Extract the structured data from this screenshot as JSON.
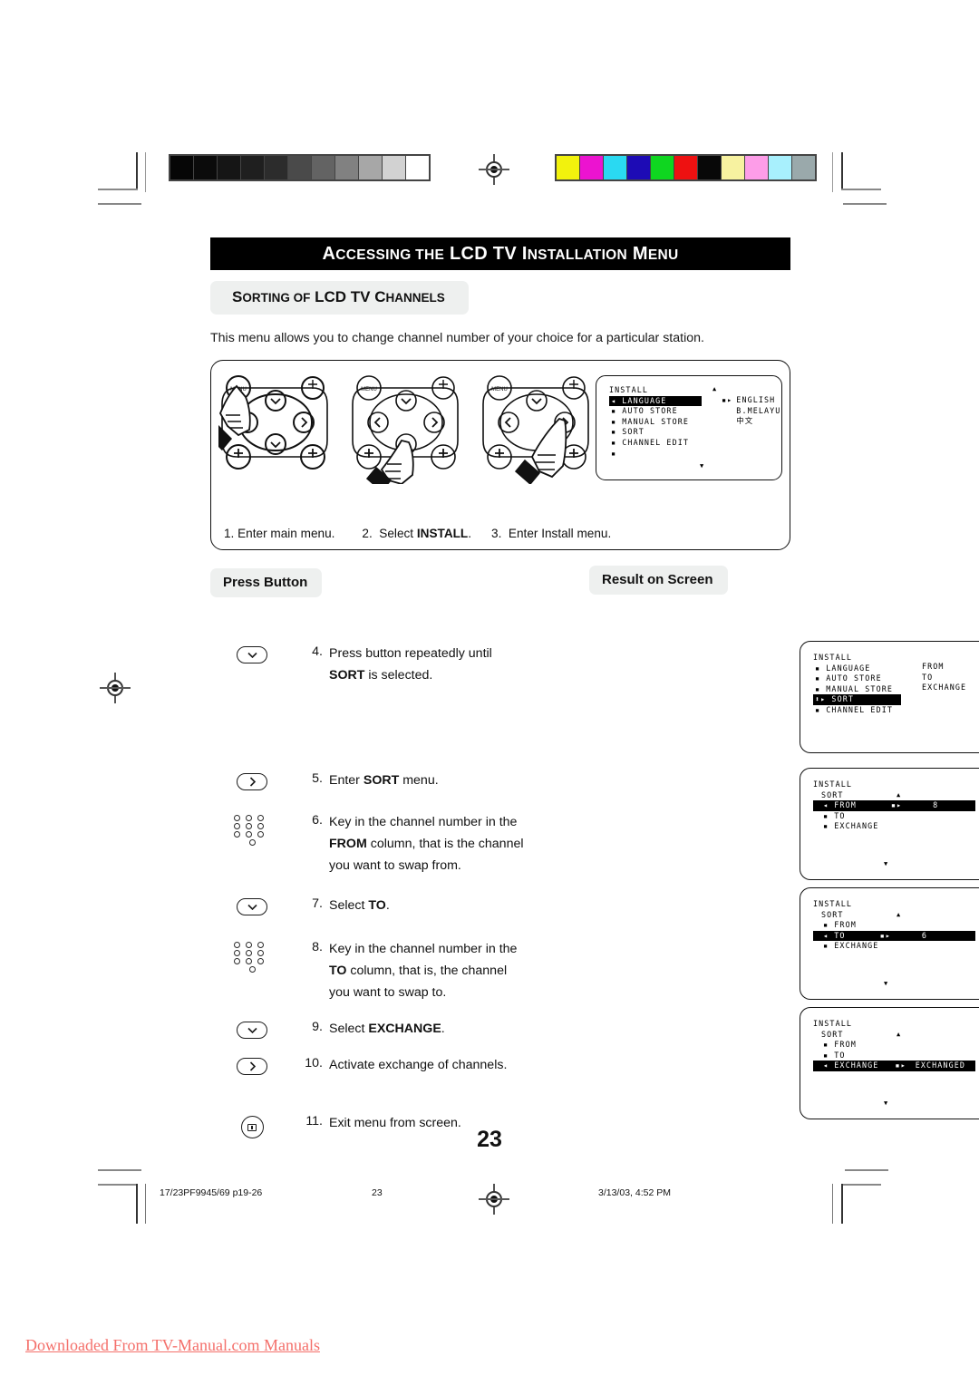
{
  "document": {
    "title": "Accessing the LCD TV Installation Menu",
    "title_parts": [
      {
        "t": "A",
        "big": true
      },
      {
        "t": "CCESSING",
        "big": false
      },
      {
        "t": " ",
        "big": false
      },
      {
        "t": "THE",
        "big": false
      },
      {
        "t": " LCD TV ",
        "big": true
      },
      {
        "t": "I",
        "big": true
      },
      {
        "t": "NSTALLATION",
        "big": false
      },
      {
        "t": " M",
        "big": true
      },
      {
        "t": "ENU",
        "big": false
      }
    ],
    "subtitle": "Sorting of LCD TV Channels",
    "intro": "This menu allows you to change channel number of your choice for a particular station.",
    "page_number": "23"
  },
  "top_panel": {
    "caption": [
      {
        "num": "1.",
        "text": "Enter main menu.",
        "bold": ""
      },
      {
        "num": "2.",
        "pre": "Select ",
        "bold": "INSTALL",
        "post": "."
      },
      {
        "num": "3.",
        "text": "Enter Install menu.",
        "bold": ""
      }
    ],
    "remote_labels": {
      "menu": "MENU",
      "expand": "expand-icon"
    },
    "osd": {
      "header": "INSTALL",
      "arrow_up": "▲",
      "arrow_down": "▼",
      "items": [
        {
          "label": "LANGUAGE",
          "highlight": true,
          "left_arrow": "◂"
        },
        {
          "label": "AUTO STORE",
          "highlight": false
        },
        {
          "label": "MANUAL STORE",
          "highlight": false
        },
        {
          "label": "SORT",
          "highlight": false
        },
        {
          "label": "CHANNEL EDIT",
          "highlight": false
        },
        {
          "label": "",
          "highlight": false
        }
      ],
      "values": [
        {
          "label": "ENGLISH",
          "marker": "▪▸"
        },
        {
          "label": "B.MELAYU",
          "marker": ""
        },
        {
          "label": "中文",
          "marker": ""
        }
      ]
    }
  },
  "columns": {
    "press_button": "Press Button",
    "result_on_screen": "Result on Screen"
  },
  "steps": [
    {
      "num": "4.",
      "icon": "down-arrow-key-icon",
      "lines": [
        {
          "pre": "Press button repeatedly until",
          "bold": "",
          "post": ""
        },
        {
          "pre": "",
          "bold": "SORT",
          "post": " is selected."
        }
      ]
    },
    {
      "num": "5.",
      "icon": "right-arrow-key-icon",
      "lines": [
        {
          "pre": "Enter ",
          "bold": "SORT",
          "post": " menu."
        }
      ]
    },
    {
      "num": "6.",
      "icon": "numeric-keypad-icon",
      "lines": [
        {
          "pre": "Key in the channel number in the",
          "bold": "",
          "post": ""
        },
        {
          "pre": "",
          "bold": "FROM",
          "post": " column, that is the channel"
        },
        {
          "pre": "you want to swap from.",
          "bold": "",
          "post": ""
        }
      ]
    },
    {
      "num": "7.",
      "icon": "down-arrow-key-icon",
      "lines": [
        {
          "pre": "Select ",
          "bold": "TO",
          "post": "."
        }
      ]
    },
    {
      "num": "8.",
      "icon": "numeric-keypad-icon",
      "lines": [
        {
          "pre": "Key in the channel number in the",
          "bold": "",
          "post": ""
        },
        {
          "pre": "",
          "bold": "TO",
          "post": " column,  that is, the channel"
        },
        {
          "pre": "you want to swap to.",
          "bold": "",
          "post": ""
        }
      ]
    },
    {
      "num": "9.",
      "icon": "down-arrow-key-icon",
      "lines": [
        {
          "pre": "Select ",
          "bold": "EXCHANGE",
          "post": "."
        }
      ]
    },
    {
      "num": "10.",
      "icon": "right-arrow-key-icon",
      "lines": [
        {
          "pre": "Activate exchange of channels.",
          "bold": "",
          "post": ""
        }
      ]
    },
    {
      "num": "11.",
      "icon": "exit-menu-key-icon",
      "lines": [
        {
          "pre": "Exit menu from screen.",
          "bold": "",
          "post": ""
        }
      ]
    }
  ],
  "result_screens": [
    {
      "header": "INSTALL",
      "sub": "",
      "arrow_up": "",
      "arrow_down": "",
      "items": [
        {
          "label": "LANGUAGE",
          "highlight": false,
          "bullet": "▪"
        },
        {
          "label": "AUTO STORE",
          "highlight": false,
          "bullet": "▪"
        },
        {
          "label": "MANUAL STORE",
          "highlight": false,
          "bullet": "▪"
        },
        {
          "label": "SORT",
          "highlight": true,
          "bullet": "⬍▸"
        },
        {
          "label": "CHANNEL EDIT",
          "highlight": false,
          "bullet": "▪"
        }
      ],
      "values": [
        "FROM",
        "TO",
        "EXCHANGE"
      ],
      "value_start_index": 0
    },
    {
      "header": "INSTALL",
      "sub": "SORT",
      "arrow_up": "▲",
      "arrow_down": "▼",
      "items": [
        {
          "label": "FROM",
          "highlight": true,
          "bullet": "◂",
          "marker": "▪▸",
          "value": "8"
        },
        {
          "label": "TO",
          "highlight": false,
          "bullet": "▪",
          "marker": "",
          "value": ""
        },
        {
          "label": "EXCHANGE",
          "highlight": false,
          "bullet": "▪",
          "marker": "",
          "value": ""
        }
      ]
    },
    {
      "header": "INSTALL",
      "sub": "SORT",
      "arrow_up": "▲",
      "arrow_down": "▼",
      "items": [
        {
          "label": "FROM",
          "highlight": false,
          "bullet": "▪",
          "marker": "",
          "value": ""
        },
        {
          "label": "TO",
          "highlight": true,
          "bullet": "◂",
          "marker": "▪▸",
          "value": "6"
        },
        {
          "label": "EXCHANGE",
          "highlight": false,
          "bullet": "▪",
          "marker": "",
          "value": ""
        }
      ]
    },
    {
      "header": "INSTALL",
      "sub": "SORT",
      "arrow_up": "▲",
      "arrow_down": "▼",
      "items": [
        {
          "label": "FROM",
          "highlight": false,
          "bullet": "▪",
          "marker": "",
          "value": ""
        },
        {
          "label": "TO",
          "highlight": false,
          "bullet": "▪",
          "marker": "",
          "value": ""
        },
        {
          "label": "EXCHANGE",
          "highlight": true,
          "bullet": "◂",
          "marker": "▪▸",
          "value": "EXCHANGED"
        }
      ]
    }
  ],
  "print_marks": {
    "grayscale": [
      "#060606",
      "#0b0b0b",
      "#151515",
      "#1f1f1f",
      "#2c2c2c",
      "#4a4a4a",
      "#636363",
      "#818181",
      "#a7a7a7",
      "#d2d2d2",
      "#ffffff"
    ],
    "colors": [
      "#f2f20d",
      "#ec13d0",
      "#2ad9f2",
      "#1d0bb5",
      "#0fd620",
      "#ee1111",
      "#080808",
      "#f7f2a0",
      "#fd9de8",
      "#a8f0fd",
      "#9aa9ab"
    ]
  },
  "footer": {
    "job": "17/23PF9945/69 p19-26",
    "page": "23",
    "timestamp": "3/13/03, 4:52 PM"
  },
  "banner": "Downloaded From TV-Manual.com Manuals"
}
